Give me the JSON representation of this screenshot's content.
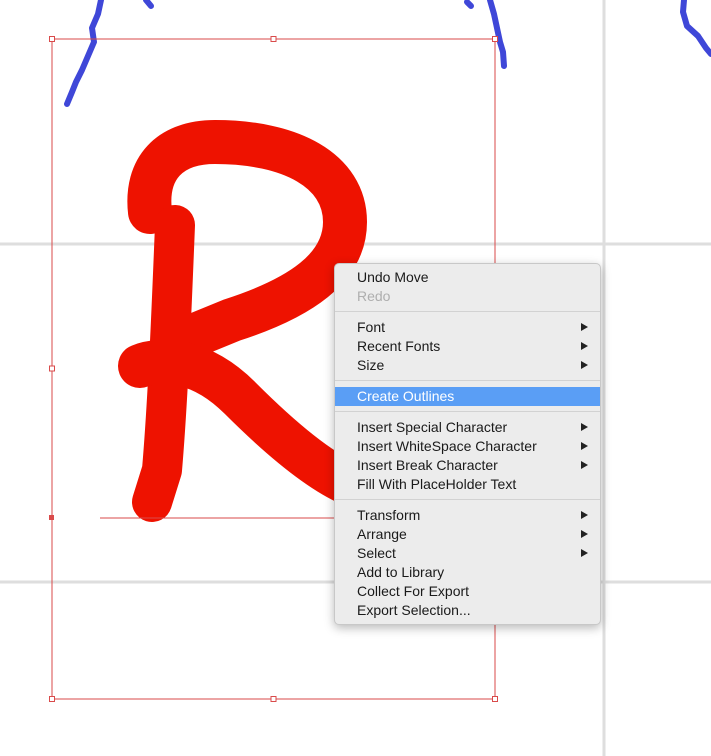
{
  "colors": {
    "glyph_fill": "#ee1200",
    "grid_line": "#dedede",
    "selection_box": "#d94a4a",
    "background_stroke": "#3f47d8",
    "menu_highlight": "#5a9ef5"
  },
  "context_menu": {
    "groups": [
      [
        {
          "label": "Undo Move",
          "enabled": true,
          "submenu": false
        },
        {
          "label": "Redo",
          "enabled": false,
          "submenu": false
        }
      ],
      [
        {
          "label": "Font",
          "enabled": true,
          "submenu": true
        },
        {
          "label": "Recent Fonts",
          "enabled": true,
          "submenu": true
        },
        {
          "label": "Size",
          "enabled": true,
          "submenu": true
        }
      ],
      [
        {
          "label": "Create Outlines",
          "enabled": true,
          "submenu": false,
          "highlighted": true
        }
      ],
      [
        {
          "label": "Insert Special Character",
          "enabled": true,
          "submenu": true
        },
        {
          "label": "Insert WhiteSpace Character",
          "enabled": true,
          "submenu": true
        },
        {
          "label": "Insert Break Character",
          "enabled": true,
          "submenu": true
        },
        {
          "label": "Fill With PlaceHolder Text",
          "enabled": true,
          "submenu": false
        }
      ],
      [
        {
          "label": "Transform",
          "enabled": true,
          "submenu": true
        },
        {
          "label": "Arrange",
          "enabled": true,
          "submenu": true
        },
        {
          "label": "Select",
          "enabled": true,
          "submenu": true
        },
        {
          "label": "Add to Library",
          "enabled": true,
          "submenu": false
        },
        {
          "label": "Collect For Export",
          "enabled": true,
          "submenu": false
        },
        {
          "label": "Export Selection...",
          "enabled": true,
          "submenu": false
        }
      ]
    ]
  }
}
